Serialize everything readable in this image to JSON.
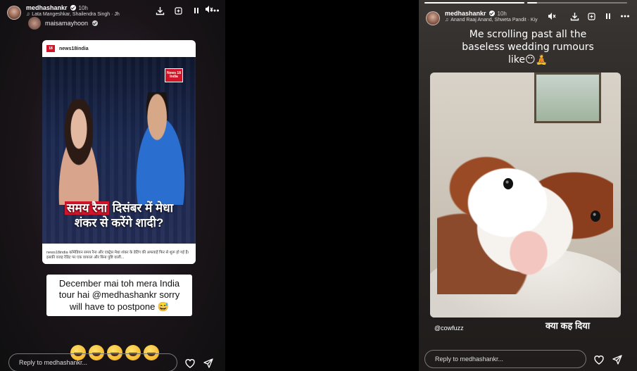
{
  "left_story": {
    "username": "medhashankr",
    "time": "10h",
    "music": "Lata Mangeshkar, Shailendra Singh · Jh",
    "mentioned_user": "maisamayhoon",
    "post": {
      "source": "news18india",
      "badge": "News 18 India",
      "headline_red": "समय रैना",
      "headline_rest_line1": "दिसंबर में मेधा",
      "headline_line2": "शंकर से करेंगे शादी?",
      "caption": "news18india कॉमेडियन समय रैना और एक्ट्रेस मेधा शंकर के डेटिंग की अफवाहें फिर से शुरू हो गई हैं। इसकी वजह रेडिट पर एक वायरल और बिना पुष्टि वाली..."
    },
    "reply_note_line1": "December mai toh mera India",
    "reply_note_line2": "tour hai @medhashankr sorry",
    "reply_note_line3": "will have to postpone 😅",
    "emoji_count": 5,
    "reply_placeholder": "Reply to medhashankr..."
  },
  "right_story": {
    "username": "medhashankr",
    "time": "10h",
    "music": "Anand Raaj Anand, Shweta Pandit · Kiy",
    "caption_line1": "Me scrolling past all the",
    "caption_line2": "baseless wedding rumours",
    "caption_line3": "like😶🧘",
    "credit": "@cowfuzz",
    "hindi_text": "क्या कह दिया",
    "reply_placeholder": "Reply to medhashankr..."
  },
  "icons": [
    "mute-icon",
    "download-icon",
    "add-to-story-icon",
    "pause-icon",
    "more-icon",
    "heart-icon",
    "send-icon",
    "verified-icon",
    "music-icon"
  ],
  "colors": {
    "news_red": "#d0152b",
    "background": "#000000"
  }
}
